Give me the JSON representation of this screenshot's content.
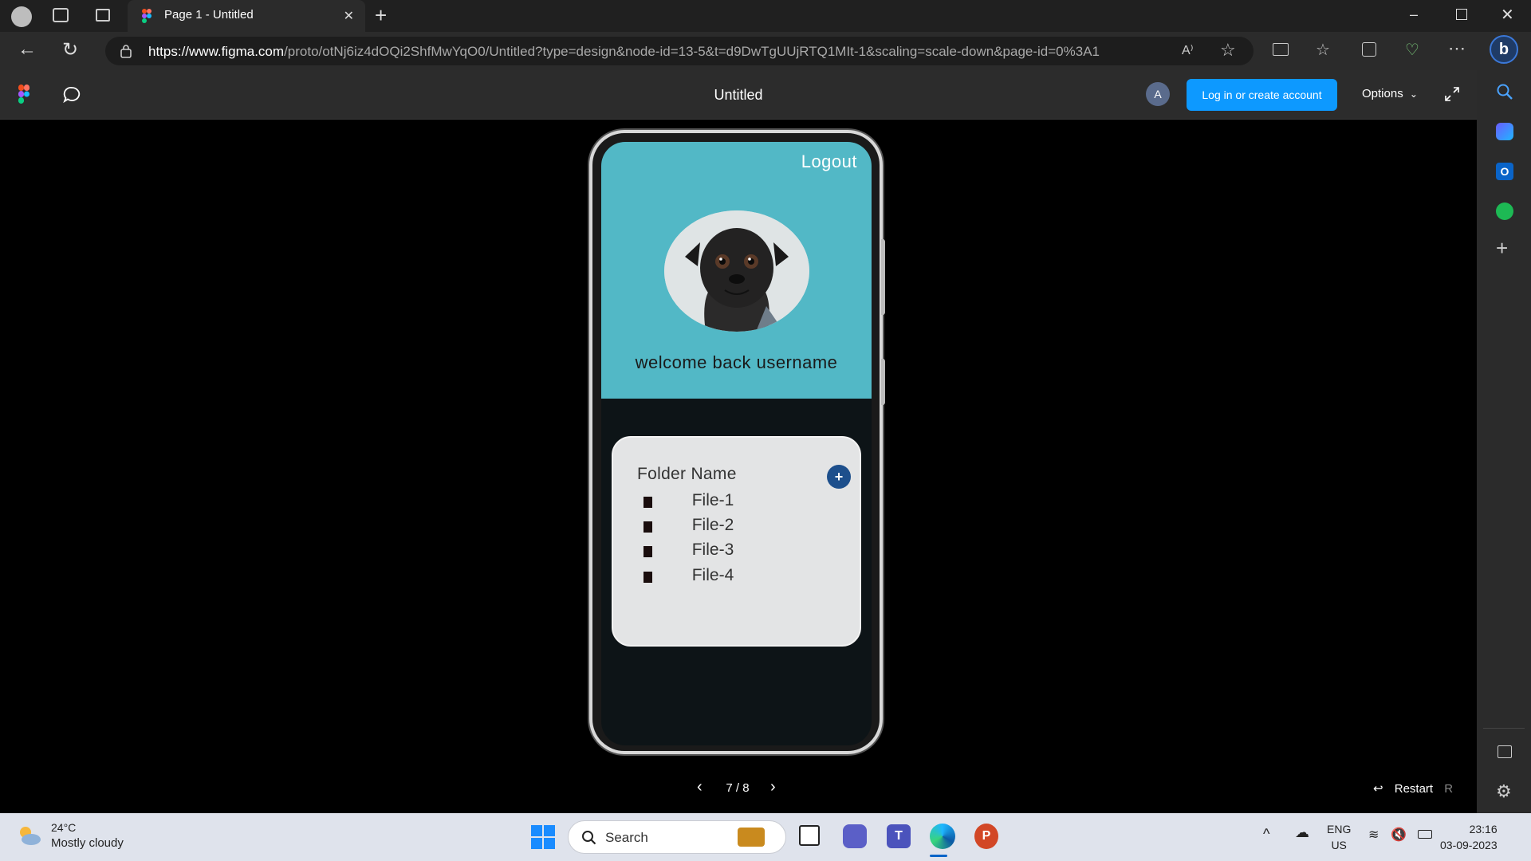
{
  "browser": {
    "tab_title": "Page 1 - Untitled",
    "url_host": "https://www.figma.com",
    "url_path": "/proto/otNj6iz4dOQi2ShfMwYqO0/Untitled?type=design&node-id=13-5&t=d9DwTgUUjRTQ1MIt-1&scaling=scale-down&page-id=0%3A1"
  },
  "figma": {
    "file_title": "Untitled",
    "avatar_initial": "A",
    "login_label": "Log in or create account",
    "options_label": "Options"
  },
  "phone": {
    "logout_label": "Logout",
    "welcome_text": "welcome back username",
    "folder_name": "Folder Name",
    "add_label": "+",
    "files": [
      "File-1",
      "File-2",
      "File-3",
      "File-4"
    ]
  },
  "prototype": {
    "page_indicator": "7 / 8",
    "restart_label": "Restart",
    "restart_shortcut": "R"
  },
  "taskbar": {
    "temperature": "24°C",
    "weather_text": "Mostly cloudy",
    "search_label": "Search",
    "lang_primary": "ENG",
    "lang_secondary": "US",
    "time": "23:16",
    "date": "03-09-2023"
  },
  "colors": {
    "hero": "#52b8c6",
    "login_button": "#0d99ff",
    "add_button": "#1d4f8c"
  }
}
